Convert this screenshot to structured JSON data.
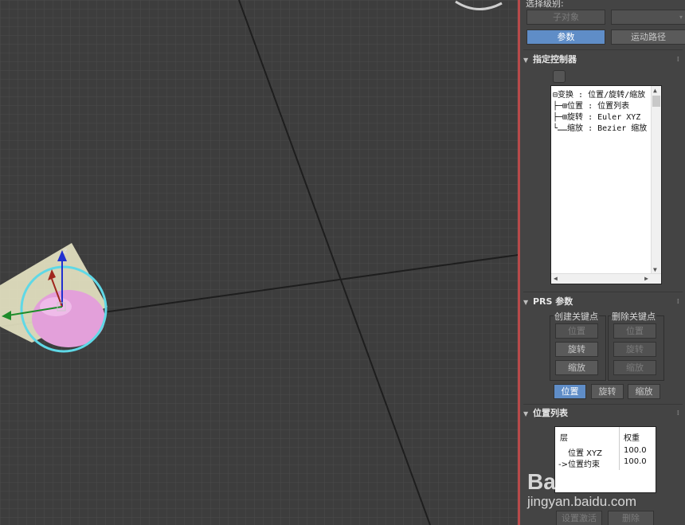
{
  "panel": {
    "select_level_label": "选择级别:",
    "sub_object_button": "子对象",
    "tabs": {
      "params": "参数",
      "motion_path": "运动路径"
    },
    "assign_controller": {
      "title": "指定控制器",
      "tree": [
        "⊟变换 : 位置/旋转/缩放",
        "├─⊞位置 : 位置列表",
        "├─⊞旋转 : Euler XYZ",
        "└……缩放 : Bezier 缩放"
      ]
    },
    "prs": {
      "title": "PRS 参数",
      "create_key_title": "创建关键点",
      "delete_key_title": "删除关键点",
      "create_buttons": [
        "位置",
        "旋转",
        "缩放"
      ],
      "delete_buttons": [
        "位置",
        "旋转",
        "缩放"
      ],
      "mode_buttons": [
        "位置",
        "旋转",
        "缩放"
      ]
    },
    "position_list": {
      "title": "位置列表",
      "col_layer": "层",
      "col_weight": "权重",
      "rows": [
        {
          "layer": "位置 XYZ",
          "weight": "100.0"
        },
        {
          "layer": "->位置约束",
          "weight": "100.0"
        }
      ],
      "set_active_button": "设置激活",
      "delete_button": "删除"
    }
  },
  "watermark": {
    "brand": "Bai 经验",
    "url": "jingyan.baidu.com"
  },
  "viewport": {
    "gizmo_axis_label": "z"
  },
  "colors": {
    "viewport_bg": "#3d3d3d",
    "panel_bg": "#444444",
    "accent_active": "#5f8dc7",
    "sphere": "#e79ae0",
    "selection_ring": "#5fd8e6"
  }
}
